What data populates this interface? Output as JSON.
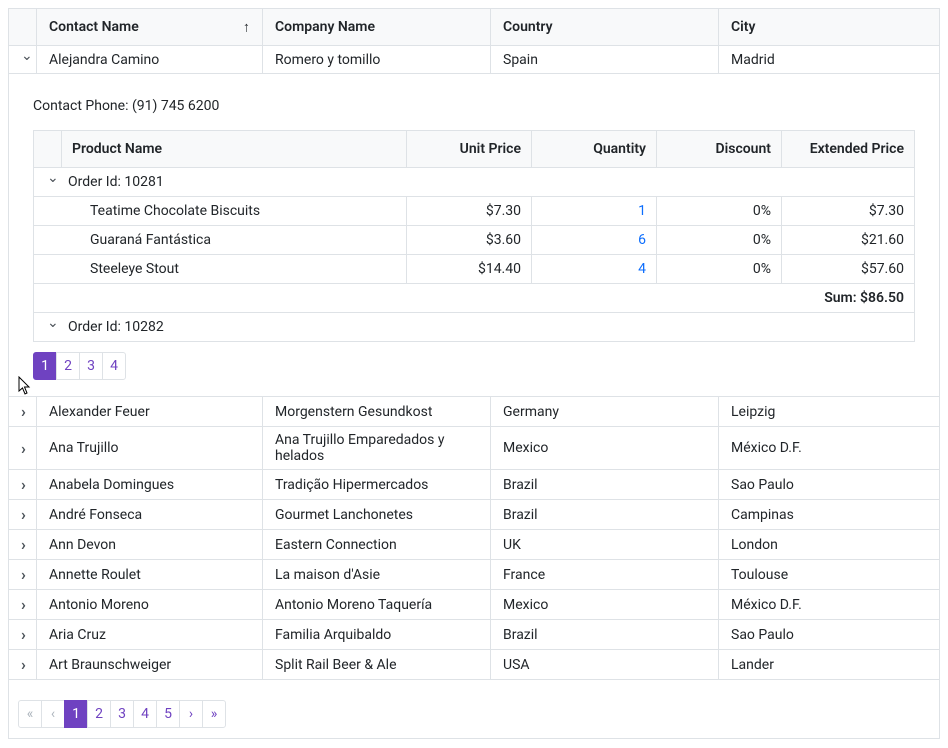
{
  "columns": {
    "contact": "Contact Name",
    "company": "Company Name",
    "country": "Country",
    "city": "City"
  },
  "expanded_row": {
    "contact": "Alejandra Camino",
    "company": "Romero y tomillo",
    "country": "Spain",
    "city": "Madrid",
    "contact_phone_label": "Contact Phone: (91) 745 6200"
  },
  "inner_columns": {
    "product": "Product Name",
    "unit_price": "Unit Price",
    "quantity": "Quantity",
    "discount": "Discount",
    "extended": "Extended Price"
  },
  "order_groups": [
    {
      "label": "Order Id: 10281",
      "expanded": true
    },
    {
      "label": "Order Id: 10282",
      "expanded": false
    }
  ],
  "order_items": [
    {
      "product": "Teatime Chocolate Biscuits",
      "price": "$7.30",
      "qty": "1",
      "disc": "0%",
      "ext": "$7.30"
    },
    {
      "product": "Guaraná Fantástica",
      "price": "$3.60",
      "qty": "6",
      "disc": "0%",
      "ext": "$21.60"
    },
    {
      "product": "Steeleye Stout",
      "price": "$14.40",
      "qty": "4",
      "disc": "0%",
      "ext": "$57.60"
    }
  ],
  "sum_label": "Sum: $86.50",
  "inner_pager": {
    "pages": [
      "1",
      "2",
      "3",
      "4"
    ],
    "active": 0
  },
  "rows": [
    {
      "contact": "Alexander Feuer",
      "company": "Morgenstern Gesundkost",
      "country": "Germany",
      "city": "Leipzig"
    },
    {
      "contact": "Ana Trujillo",
      "company": "Ana Trujillo Emparedados y helados",
      "country": "Mexico",
      "city": "México D.F."
    },
    {
      "contact": "Anabela Domingues",
      "company": "Tradição Hipermercados",
      "country": "Brazil",
      "city": "Sao Paulo"
    },
    {
      "contact": "André Fonseca",
      "company": "Gourmet Lanchonetes",
      "country": "Brazil",
      "city": "Campinas"
    },
    {
      "contact": "Ann Devon",
      "company": "Eastern Connection",
      "country": "UK",
      "city": "London"
    },
    {
      "contact": "Annette Roulet",
      "company": "La maison d'Asie",
      "country": "France",
      "city": "Toulouse"
    },
    {
      "contact": "Antonio Moreno",
      "company": "Antonio Moreno Taquería",
      "country": "Mexico",
      "city": "México D.F."
    },
    {
      "contact": "Aria Cruz",
      "company": "Familia Arquibaldo",
      "country": "Brazil",
      "city": "Sao Paulo"
    },
    {
      "contact": "Art Braunschweiger",
      "company": "Split Rail Beer & Ale",
      "country": "USA",
      "city": "Lander"
    }
  ],
  "outer_pager": {
    "pages": [
      "1",
      "2",
      "3",
      "4",
      "5"
    ],
    "active": 0
  }
}
